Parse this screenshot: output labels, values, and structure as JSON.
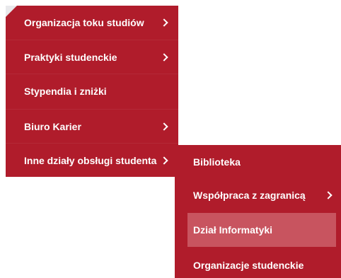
{
  "primary_menu": {
    "items": [
      {
        "label": "Organizacja toku studiów",
        "icon": "chevron-right-icon"
      },
      {
        "label": "Praktyki studenckie",
        "icon": "chevron-right-icon"
      },
      {
        "label": "Stypendia i zniżki"
      },
      {
        "label": "Biuro Karier",
        "icon": "chevron-right-icon"
      },
      {
        "label": "Inne działy obsługi studenta",
        "icon": "chevron-right-icon"
      }
    ]
  },
  "submenu": {
    "items": [
      {
        "label": "Biblioteka"
      },
      {
        "label": "Współpraca z zagranicą",
        "icon": "chevron-right-icon"
      },
      {
        "label": "Dział Informatyki",
        "state": "hovered"
      },
      {
        "label": "Organizacje studenckie"
      }
    ]
  },
  "colors": {
    "menu_background": "#b01c2b",
    "hover_background": "#c8545f",
    "text": "#ffffff",
    "corner_fold": "#e9e9ec"
  }
}
